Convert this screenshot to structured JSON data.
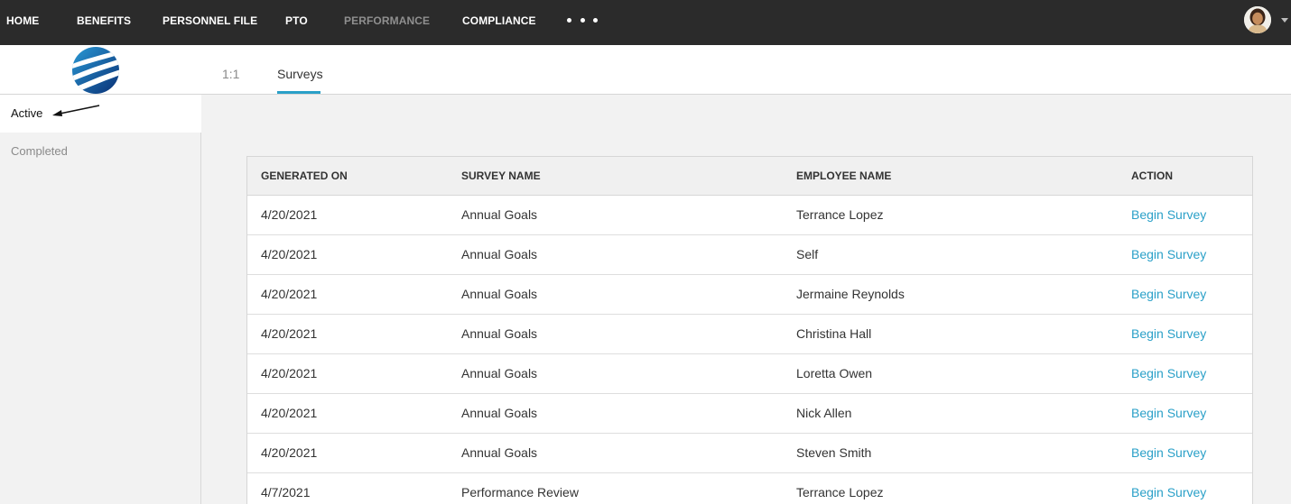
{
  "nav": {
    "items": [
      "HOME",
      "BENEFITS",
      "PERSONNEL FILE",
      "PTO",
      "PERFORMANCE",
      "COMPLIANCE"
    ],
    "active": "PERFORMANCE",
    "more_icon": "more-dots-icon",
    "avatar_icon": "user-avatar-icon"
  },
  "tabs": [
    "1:1",
    "Surveys"
  ],
  "active_tab": "Surveys",
  "sidebar": {
    "items": [
      "Active",
      "Completed"
    ],
    "active": "Active"
  },
  "table": {
    "headers": [
      "GENERATED ON",
      "SURVEY NAME",
      "EMPLOYEE NAME",
      "ACTION"
    ],
    "rows": [
      [
        "4/20/2021",
        "Annual Goals",
        "Terrance Lopez",
        "Begin Survey"
      ],
      [
        "4/20/2021",
        "Annual Goals",
        "Self",
        "Begin Survey"
      ],
      [
        "4/20/2021",
        "Annual Goals",
        "Jermaine Reynolds",
        "Begin Survey"
      ],
      [
        "4/20/2021",
        "Annual Goals",
        "Christina Hall",
        "Begin Survey"
      ],
      [
        "4/20/2021",
        "Annual Goals",
        "Loretta Owen",
        "Begin Survey"
      ],
      [
        "4/20/2021",
        "Annual Goals",
        "Nick Allen",
        "Begin Survey"
      ],
      [
        "4/20/2021",
        "Annual Goals",
        "Steven Smith",
        "Begin Survey"
      ],
      [
        "4/7/2021",
        "Performance Review",
        "Terrance Lopez",
        "Begin Survey"
      ]
    ]
  },
  "colors": {
    "nav_bg": "#2b2b2b",
    "accent": "#2aa0c8",
    "link": "#2aa0c8"
  }
}
